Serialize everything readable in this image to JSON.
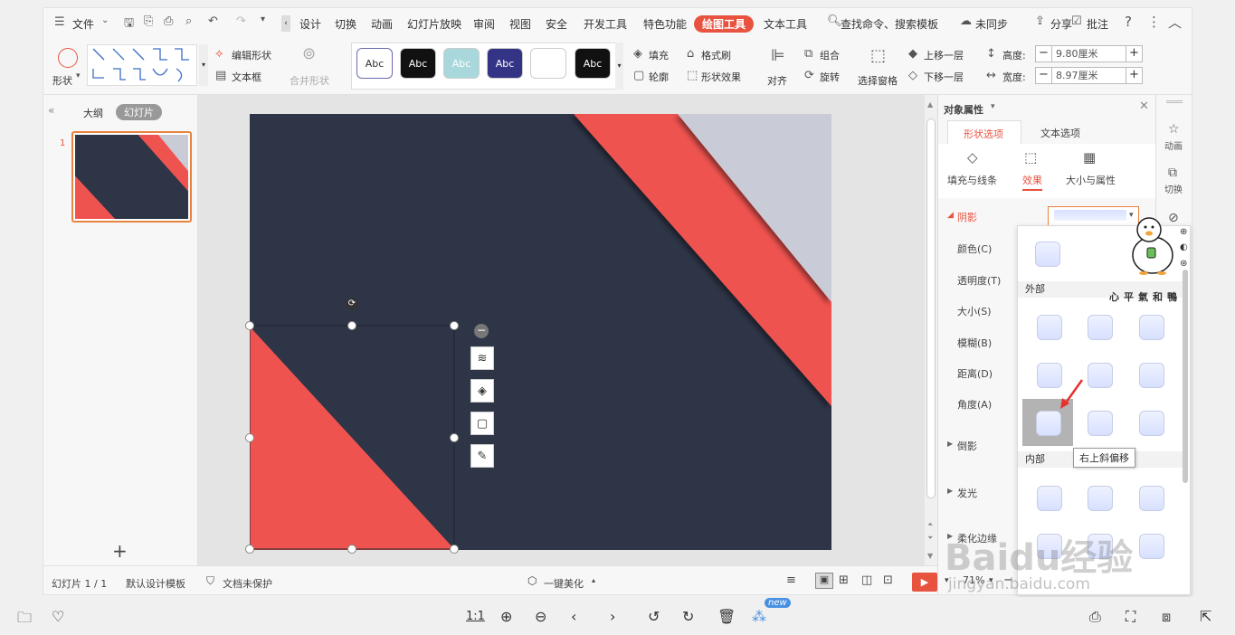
{
  "menu": {
    "file": "文件",
    "tabs": [
      "设计",
      "切换",
      "动画",
      "幻灯片放映",
      "审阅",
      "视图",
      "安全",
      "开发工具",
      "特色功能",
      "绘图工具",
      "文本工具"
    ],
    "search": "查找命令、搜索模板",
    "unsync": "未同步",
    "share": "分享",
    "comment": "批注"
  },
  "ribbon": {
    "shape": "形状",
    "edit_shape": "编辑形状",
    "text_box": "文本框",
    "merge_shape": "合并形状",
    "style_sample": "Abc",
    "fill": "填充",
    "format_painter": "格式刷",
    "outline": "轮廓",
    "shape_effect": "形状效果",
    "align": "对齐",
    "group": "组合",
    "rotate": "旋转",
    "select_pane": "选择窗格",
    "bring_forward": "上移一层",
    "send_backward": "下移一层",
    "height_label": "高度:",
    "height_value": "9.80厘米",
    "width_label": "宽度:",
    "width_value": "8.97厘米",
    "minus": "−",
    "plus": "+"
  },
  "sidebar": {
    "outline": "大纲",
    "slides": "幻灯片",
    "slide_number": "1",
    "add": "+"
  },
  "panel": {
    "title": "对象属性",
    "tab_shape": "形状选项",
    "tab_text": "文本选项",
    "sub_fill": "填充与线条",
    "sub_effect": "效果",
    "sub_size": "大小与属性",
    "shadow": "阴影",
    "color": "颜色(C)",
    "transparency": "透明度(T)",
    "size": "大小(S)",
    "blur": "模糊(B)",
    "distance": "距离(D)",
    "angle": "角度(A)",
    "reflection": "倒影",
    "glow": "发光",
    "soft_edge": "柔化边缘"
  },
  "gallery": {
    "outer": "外部",
    "inner": "内部",
    "tooltip": "右上斜偏移"
  },
  "rtool": {
    "animation": "动画",
    "transition": "切换"
  },
  "watermark": {
    "caption": "心平氣和鴨",
    "brand": "Baidu经验",
    "url": "jingyan.baidu.com"
  },
  "status": {
    "slide_info": "幻灯片 1 / 1",
    "template": "默认设计模板",
    "protect": "文档未保护",
    "beautify": "一键美化",
    "zoom": "71%"
  },
  "viewer": {
    "ratio": "1:1",
    "new_badge": "new"
  },
  "colors": {
    "accent": "#e8533f",
    "slide_dark": "#2e3547",
    "slide_red": "#ef5350",
    "slide_gray": "#c9ccd6"
  }
}
